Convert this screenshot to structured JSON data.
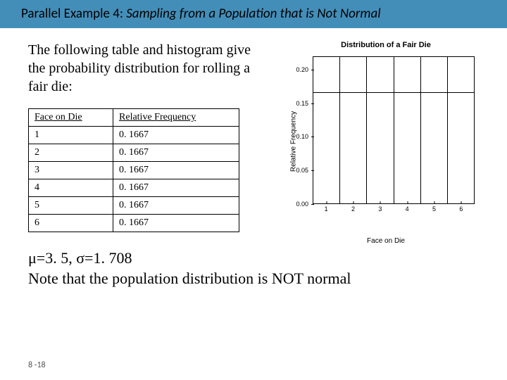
{
  "title": {
    "lead": "Parallel Example 4:",
    "rest": " Sampling from a Population that is Not Normal"
  },
  "intro": "The following table and histogram give the probability distribution for rolling a fair die:",
  "table": {
    "head": {
      "c1": "Face on Die",
      "c2": "Relative Frequency"
    },
    "rows": [
      {
        "c1": "1",
        "c2": "0. 1667"
      },
      {
        "c1": "2",
        "c2": "0. 1667"
      },
      {
        "c1": "3",
        "c2": "0. 1667"
      },
      {
        "c1": "4",
        "c2": "0. 1667"
      },
      {
        "c1": "5",
        "c2": "0. 1667"
      },
      {
        "c1": "6",
        "c2": "0. 1667"
      }
    ]
  },
  "chart_data": {
    "type": "bar",
    "title": "Distribution of a Fair Die",
    "xlabel": "Face on Die",
    "ylabel": "Relative Frequency",
    "categories": [
      "1",
      "2",
      "3",
      "4",
      "5",
      "6"
    ],
    "values": [
      0.1667,
      0.1667,
      0.1667,
      0.1667,
      0.1667,
      0.1667
    ],
    "ylim": [
      0,
      0.22
    ],
    "yticks": [
      "0.00",
      "0.05",
      "0.10",
      "0.15",
      "0.20"
    ]
  },
  "footer": {
    "line1": "μ=3. 5,  σ=1. 708",
    "line2": "Note that the population distribution is NOT normal"
  },
  "slide_num": "8 -18"
}
